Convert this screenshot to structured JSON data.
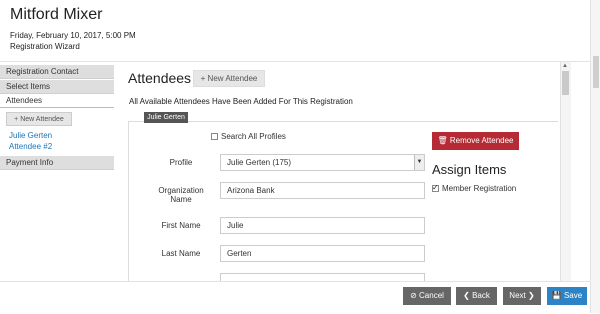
{
  "header": {
    "title": "Mitford Mixer",
    "datetime": "Friday, February 10, 2017, 5:00 PM",
    "subtitle": "Registration Wizard"
  },
  "sidebar": {
    "items": [
      {
        "label": "Registration Contact"
      },
      {
        "label": "Select Items"
      },
      {
        "label": "Attendees"
      }
    ],
    "new_attendee_label": "New Attendee",
    "attendees": [
      "Julie Gerten",
      "Attendee #2"
    ],
    "payment_info": "Payment Info"
  },
  "main": {
    "heading": "Attendees",
    "new_attendee_label": "New Attendee",
    "message": "All Available Attendees Have Been Added For This Registration",
    "tab_label": "Julie Gerten",
    "search_all_profiles": "Search All Profiles",
    "profile_label": "Profile",
    "profile_value": "Julie Gerten  (175)",
    "org_label": "Organization Name",
    "org_value": "Arizona Bank",
    "first_name_label": "First Name",
    "first_name_value": "Julie",
    "last_name_label": "Last Name",
    "last_name_value": "Gerten",
    "remove_attendee": "Remove Attendee",
    "assign_items": "Assign Items",
    "member_registration": "Member Registration"
  },
  "footer": {
    "cancel": "Cancel",
    "back": "Back",
    "next": "Next",
    "save": "Save"
  },
  "colors": {
    "remove": "#b52a35",
    "save": "#2c84c6",
    "link": "#1a75b8"
  }
}
